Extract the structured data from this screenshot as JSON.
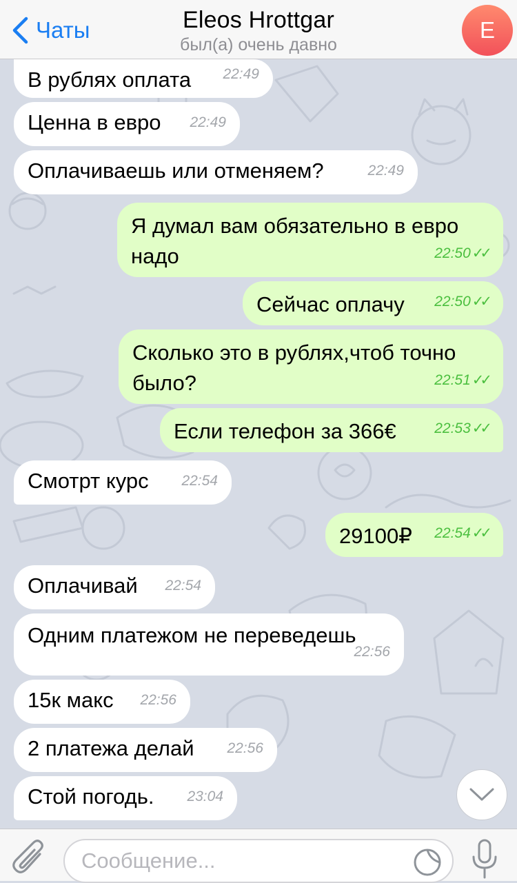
{
  "header": {
    "back_label": "Чаты",
    "title": "Eleos Hrottgar",
    "subtitle": "был(а) очень давно",
    "avatar_letter": "E"
  },
  "messages": [
    {
      "text": "В рублях оплата",
      "time": "22:49"
    },
    {
      "text": "Ценна в евро",
      "time": "22:49"
    },
    {
      "text": "Оплачиваешь или отменяем?",
      "time": "22:49"
    },
    {
      "text1": "Я думал вам обязательно в евро",
      "text2": "надо",
      "time": "22:50"
    },
    {
      "text": "Сейчас оплачу",
      "time": "22:50"
    },
    {
      "text1": "Сколько это в рублях,чтоб точно",
      "text2": "было?",
      "time": "22:51"
    },
    {
      "text": "Если телефон за 366€",
      "time": "22:53"
    },
    {
      "text": "Смотрт курс",
      "time": "22:54"
    },
    {
      "text": "29100₽",
      "time": "22:54"
    },
    {
      "text": "Оплачивай",
      "time": "22:54"
    },
    {
      "text": "Одним платежом не переведешь",
      "time": "22:56"
    },
    {
      "text": "15к макс",
      "time": "22:56"
    },
    {
      "text": "2 платежа делай",
      "time": "22:56"
    },
    {
      "text": "Стой погодь.",
      "time": "23:04"
    }
  ],
  "composer": {
    "placeholder": "Сообщение..."
  },
  "icons": {
    "back": "chevron-left-icon",
    "attach": "paperclip-icon",
    "sticker": "sticker-icon",
    "mic": "microphone-icon",
    "scroll": "chevron-down-icon",
    "read": "double-check-icon"
  },
  "colors": {
    "accent": "#1a7ef2",
    "outgoing_bubble": "#e1fec7",
    "incoming_bubble": "#ffffff",
    "read_check": "#4bbf3f",
    "chat_background": "#d6dbe5",
    "avatar_from": "#ff8a6e",
    "avatar_to": "#f2515a"
  }
}
